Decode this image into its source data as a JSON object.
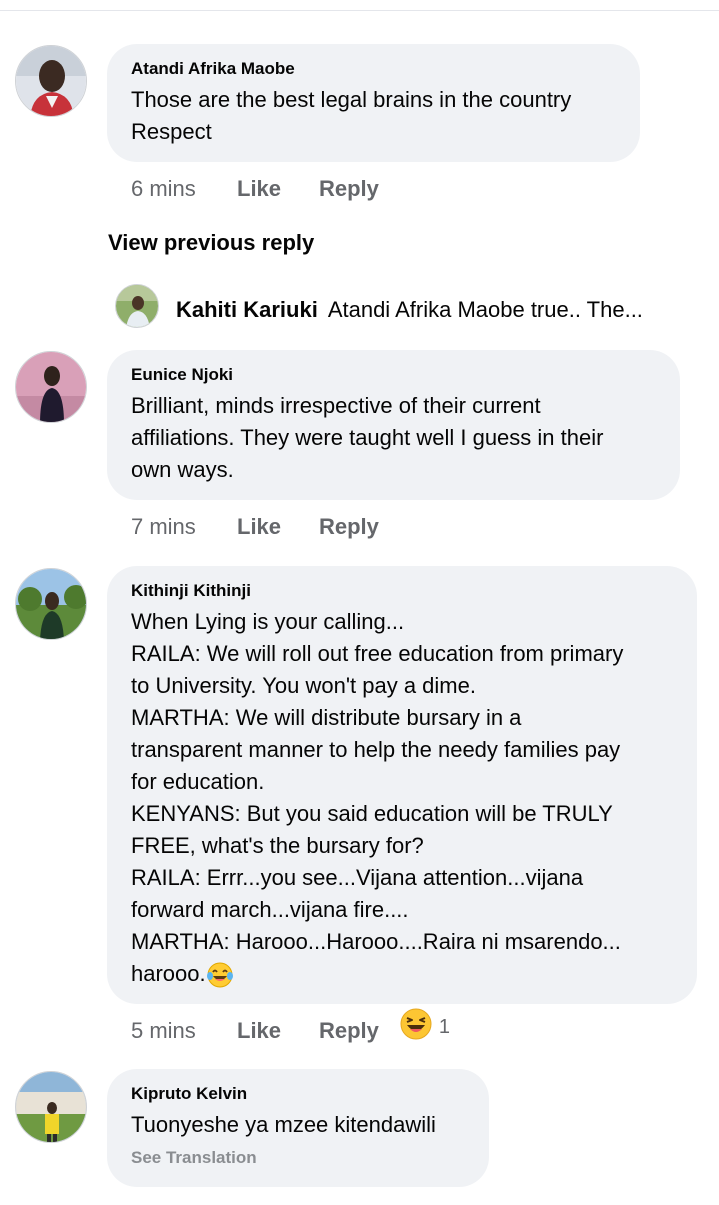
{
  "comments": [
    {
      "author": "Atandi Afrika Maobe",
      "text": "Those are the best legal brains in  the country\nRespect",
      "time": "6 mins",
      "like": "Like",
      "reply": "Reply"
    },
    {
      "author": "Eunice Njoki",
      "text": "Brilliant, minds irrespective of their current\naffiliations.  They were taught well I guess in their\nown ways.",
      "time": "7 mins",
      "like": "Like",
      "reply": "Reply"
    },
    {
      "author": "Kithinji Kithinji",
      "text": "When Lying is your calling...\nRAILA: We will roll out free education from primary\nto University. You won't pay a dime.\nMARTHA: We will distribute bursary in a\ntransparent manner to help the needy families pay\nfor education.\nKENYANS: But you said education will be TRULY\nFREE, what's the bursary for?\nRAILA: Errr...you see...Vijana attention...vijana\nforward march...vijana fire....\nMARTHA: Harooo...Harooo....Raira ni msarendo...\nharooo.",
      "time": "5 mins",
      "like": "Like",
      "reply": "Reply",
      "reaction_count": "1"
    },
    {
      "author": "Kipruto Kelvin",
      "text": "Tuonyeshe ya mzee kitendawili",
      "translation": "See Translation"
    }
  ],
  "view_previous": "View previous reply",
  "reply_preview": {
    "author": "Kahiti Kariuki",
    "text": "Atandi Afrika Maobe true.. The..."
  },
  "icons": {
    "inline_emoji": "tears-of-joy-emoji",
    "reaction": "haha-reaction-icon"
  },
  "colors": {
    "bubble": "#f0f2f5",
    "meta": "#65676b",
    "translation": "#8a8d91"
  }
}
